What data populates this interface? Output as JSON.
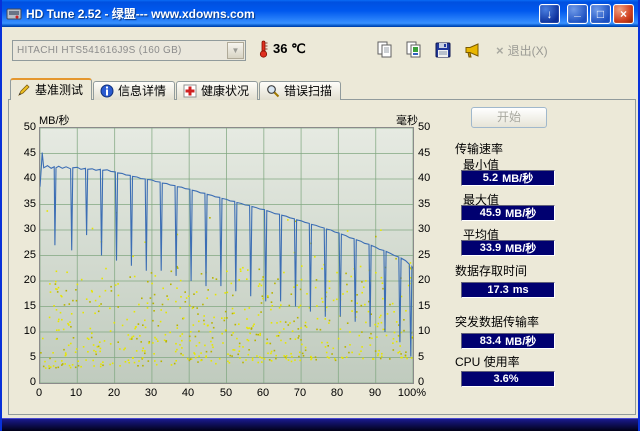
{
  "window": {
    "title": "HD Tune 2.52 - 绿盟--- www.xdowns.com",
    "controls": {
      "download": "↓",
      "minimize": "_",
      "maximize": "□",
      "close": "×"
    }
  },
  "toolbar": {
    "drive_select": {
      "value": "HITACHI HTS541616J9S (160 GB)",
      "arrow": "▼"
    },
    "temperature": {
      "value": "36",
      "unit": "℃"
    },
    "tool_buttons": [
      {
        "icon": "copy-pages-icon"
      },
      {
        "icon": "copy-image-icon"
      },
      {
        "icon": "save-floppy-icon"
      },
      {
        "icon": "horn-icon"
      }
    ],
    "exit": {
      "label": "退出(X)",
      "icon": "×"
    }
  },
  "tabs": [
    {
      "label": "基准测试",
      "icon": "pencil-icon",
      "active": true
    },
    {
      "label": "信息详情",
      "icon": "info-icon",
      "active": false
    },
    {
      "label": "健康状况",
      "icon": "red-cross-icon",
      "active": false
    },
    {
      "label": "错误扫描",
      "icon": "magnifier-icon",
      "active": false
    }
  ],
  "benchmark": {
    "start_button": "开始",
    "results": {
      "group_label": "传输速率",
      "rows": [
        {
          "label": "最小值",
          "value": "5.2",
          "unit": "MB/秒"
        },
        {
          "label": "最大值",
          "value": "45.9",
          "unit": "MB/秒"
        },
        {
          "label": "平均值",
          "value": "33.9",
          "unit": "MB/秒"
        },
        {
          "label": "数据存取时间",
          "value": "17.3",
          "unit": "ms"
        },
        {
          "label": "突发数据传输率",
          "value": "83.4",
          "unit": "MB/秒"
        },
        {
          "label": "CPU 使用率",
          "value": "3.6%",
          "unit": ""
        }
      ]
    }
  },
  "chart_data": {
    "type": "line",
    "left_axis": "MB/秒",
    "right_axis": "毫秒",
    "xlim": [
      0,
      100
    ],
    "ylim": [
      0,
      50
    ],
    "grid": true,
    "x_ticks": [
      "0",
      "10",
      "20",
      "30",
      "40",
      "50",
      "60",
      "70",
      "80",
      "90",
      "100%"
    ],
    "y_ticks": [
      50,
      45,
      40,
      35,
      30,
      25,
      20,
      15,
      10,
      5,
      0
    ],
    "series": [
      {
        "name": "传输速率",
        "unit": "MB/秒",
        "color": "#3c6eb4",
        "style": "line",
        "points": [
          [
            0,
            38.5
          ],
          [
            0.4,
            42.8
          ],
          [
            0.6,
            45.2
          ],
          [
            1,
            42.2
          ],
          [
            2,
            42.6
          ],
          [
            3,
            42.1
          ],
          [
            3.8,
            42.4
          ],
          [
            4,
            27
          ],
          [
            4.3,
            42.2
          ],
          [
            5,
            42.5
          ],
          [
            6,
            42.1
          ],
          [
            7,
            42.4
          ],
          [
            8.2,
            42
          ],
          [
            8.5,
            26
          ],
          [
            8.8,
            42.2
          ],
          [
            10,
            42.3
          ],
          [
            11,
            41.9
          ],
          [
            12.2,
            42.1
          ],
          [
            12.5,
            29
          ],
          [
            12.8,
            41.9
          ],
          [
            14,
            42
          ],
          [
            15,
            41.7
          ],
          [
            16.2,
            41.9
          ],
          [
            16.5,
            25
          ],
          [
            16.8,
            41.7
          ],
          [
            18,
            41.8
          ],
          [
            19,
            41.5
          ],
          [
            20.2,
            41.4
          ],
          [
            20.5,
            24
          ],
          [
            20.8,
            41.2
          ],
          [
            22,
            41.1
          ],
          [
            23,
            40.8
          ],
          [
            24.2,
            40.7
          ],
          [
            24.5,
            23
          ],
          [
            24.8,
            40.5
          ],
          [
            26,
            40.4
          ],
          [
            27,
            40.1
          ],
          [
            28.2,
            40
          ],
          [
            28.5,
            22
          ],
          [
            28.8,
            39.9
          ],
          [
            30,
            39.8
          ],
          [
            31,
            39.5
          ],
          [
            32.2,
            39.4
          ],
          [
            32.5,
            22
          ],
          [
            32.8,
            39.2
          ],
          [
            34,
            39.1
          ],
          [
            35,
            38.8
          ],
          [
            36.2,
            38.7
          ],
          [
            36.5,
            21
          ],
          [
            36.8,
            38.5
          ],
          [
            38,
            38.4
          ],
          [
            39,
            38.1
          ],
          [
            40.2,
            38
          ],
          [
            40.5,
            20
          ],
          [
            40.8,
            37.8
          ],
          [
            42,
            37.6
          ],
          [
            43,
            37.3
          ],
          [
            44.2,
            37.2
          ],
          [
            44.5,
            19
          ],
          [
            44.8,
            37
          ],
          [
            46,
            36.8
          ],
          [
            47,
            36.5
          ],
          [
            48.2,
            36.4
          ],
          [
            48.5,
            19
          ],
          [
            48.8,
            36.2
          ],
          [
            50,
            36
          ],
          [
            51,
            35.7
          ],
          [
            52.2,
            35.6
          ],
          [
            52.5,
            18
          ],
          [
            52.8,
            35.4
          ],
          [
            54,
            35.2
          ],
          [
            55,
            34.9
          ],
          [
            56.2,
            34.8
          ],
          [
            56.5,
            17
          ],
          [
            56.8,
            34.6
          ],
          [
            58,
            34.4
          ],
          [
            59,
            34.1
          ],
          [
            60.2,
            34
          ],
          [
            60.5,
            16
          ],
          [
            60.8,
            33.8
          ],
          [
            62,
            33.5
          ],
          [
            63,
            33.2
          ],
          [
            64.2,
            33.1
          ],
          [
            64.5,
            16
          ],
          [
            64.8,
            32.9
          ],
          [
            66,
            32.7
          ],
          [
            67,
            32.4
          ],
          [
            68.2,
            32.2
          ],
          [
            68.5,
            15
          ],
          [
            68.8,
            32
          ],
          [
            70,
            31.8
          ],
          [
            71,
            31.5
          ],
          [
            72.2,
            31.3
          ],
          [
            72.5,
            14
          ],
          [
            72.8,
            31.1
          ],
          [
            74,
            30.9
          ],
          [
            75,
            30.6
          ],
          [
            76.2,
            30.4
          ],
          [
            76.5,
            13
          ],
          [
            76.8,
            30.2
          ],
          [
            78,
            30
          ],
          [
            79,
            29.6
          ],
          [
            80.2,
            29.4
          ],
          [
            80.5,
            13
          ],
          [
            80.8,
            29.2
          ],
          [
            82,
            28.9
          ],
          [
            83,
            28.5
          ],
          [
            84.2,
            28.3
          ],
          [
            84.5,
            12
          ],
          [
            84.8,
            28.1
          ],
          [
            86,
            27.8
          ],
          [
            87,
            27.4
          ],
          [
            88.2,
            27.2
          ],
          [
            88.5,
            11
          ],
          [
            88.8,
            27
          ],
          [
            90,
            26.6
          ],
          [
            91,
            26.2
          ],
          [
            92.2,
            26
          ],
          [
            92.5,
            10
          ],
          [
            92.8,
            25.8
          ],
          [
            94,
            25.4
          ],
          [
            95,
            25
          ],
          [
            96.2,
            24.7
          ],
          [
            96.5,
            8
          ],
          [
            96.8,
            24.5
          ],
          [
            98,
            24
          ],
          [
            99,
            23.3
          ],
          [
            99.4,
            5.2
          ],
          [
            99.7,
            22.8
          ],
          [
            100,
            22.5
          ]
        ]
      },
      {
        "name": "存取时间",
        "unit": "毫秒",
        "color": "#e6e600",
        "style": "scatter",
        "approx": {
          "count": 620,
          "y_min": 3,
          "y_max": 22,
          "outlier_max": 34,
          "seed": 1234567
        }
      }
    ]
  }
}
